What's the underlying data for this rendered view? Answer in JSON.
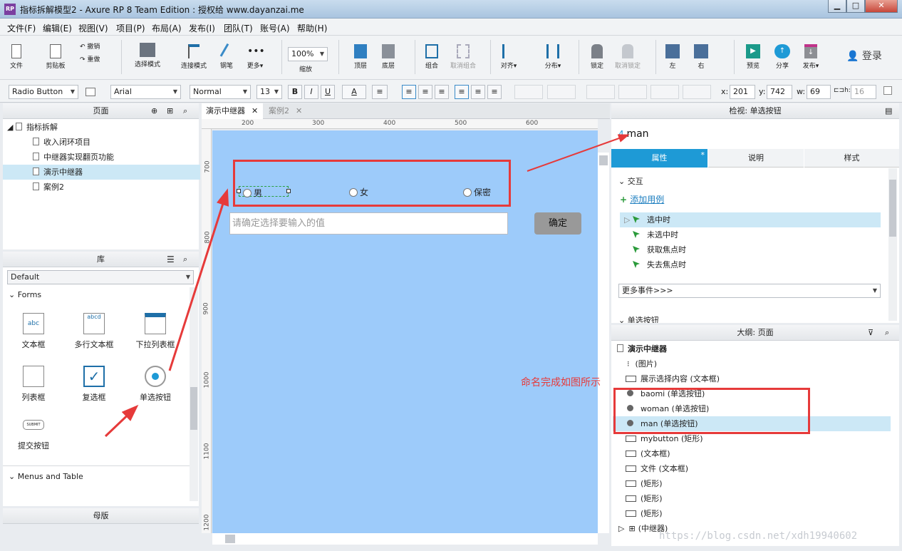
{
  "window": {
    "title": "指标拆解模型2 - Axure RP 8 Team Edition : 授权给 www.dayanzai.me",
    "app_icon": "RP",
    "min": "▁",
    "max": "□",
    "close": "✕"
  },
  "menu": [
    "文件(F)",
    "编辑(E)",
    "视图(V)",
    "项目(P)",
    "布局(A)",
    "发布(I)",
    "团队(T)",
    "账号(A)",
    "帮助(H)"
  ],
  "toolbar": {
    "file": "文件",
    "clipboard": "剪贴板",
    "undo": "撤销",
    "redo": "重做",
    "select_mode": "选择模式",
    "connect_mode": "连接模式",
    "pen": "钢笔",
    "more": "更多▾",
    "zoom_value": "100%",
    "zoom": "缩放",
    "top": "顶层",
    "bottom": "底层",
    "group": "组合",
    "ungroup": "取消组合",
    "align": "对齐▾",
    "distribute": "分布▾",
    "lock": "锁定",
    "unlock": "取消锁定",
    "left": "左",
    "right": "右",
    "preview": "预览",
    "share": "分享",
    "publish": "发布▾",
    "login": "登录"
  },
  "format": {
    "widget_type": "Radio Button",
    "font": "Arial",
    "style": "Normal",
    "size": "13",
    "bold": "B",
    "italic": "I",
    "underline": "U",
    "font_color": "A",
    "x_label": "x:",
    "x": "201",
    "y_label": "y:",
    "y": "742",
    "w_label": "w:",
    "w": "69",
    "h": "16"
  },
  "pages": {
    "title": "页面",
    "root": "指标拆解",
    "items": [
      "收入闭环项目",
      "中继器实现翻页功能",
      "演示中继器",
      "案例2"
    ],
    "selected": 2
  },
  "library": {
    "title": "库",
    "selected": "Default",
    "section": "Forms",
    "items": [
      "文本框",
      "多行文本框",
      "下拉列表框",
      "列表框",
      "复选框",
      "单选按钮",
      "提交按钮"
    ],
    "section2": "Menus and Table",
    "masters": "母版"
  },
  "tabs": [
    {
      "label": "演示中继器",
      "close": "✕"
    },
    {
      "label": "案例2",
      "close": "✕"
    }
  ],
  "ruler": {
    "h": [
      "200",
      "300",
      "400",
      "500",
      "600",
      "700"
    ],
    "v": [
      "700",
      "800",
      "900",
      "1000",
      "1100",
      "1200"
    ]
  },
  "canvas": {
    "radio_male": "男",
    "radio_female": "女",
    "radio_secret": "保密",
    "input_placeholder": "请确定选择要输入的值",
    "confirm": "确定"
  },
  "inspector": {
    "title": "检视: 单选按钮",
    "name": "man",
    "tabs": [
      "属性",
      "说明",
      "样式"
    ],
    "active_mark": "*",
    "interaction": "交互",
    "add_case": "添加用例",
    "events": [
      "选中时",
      "未选中时",
      "获取焦点时",
      "失去焦点时"
    ],
    "more_events": "更多事件>>>",
    "next_section": "单选按钮"
  },
  "outline": {
    "title": "大纲: 页面",
    "page": "演示中继器",
    "items": [
      "(图片)",
      "展示选择内容 (文本框)",
      "baomi (单选按钮)",
      "woman (单选按钮)",
      "man (单选按钮)",
      "mybutton (矩形)",
      "(文本框)",
      "文件 (文本框)",
      "(矩形)",
      "(矩形)",
      "(矩形)",
      "(中继器)"
    ]
  },
  "annotation": "命名完成如图所示",
  "watermark": "https://blog.csdn.net/xdh19940602",
  "colors": {
    "accent": "#1e9ad6",
    "canvas": "#9dcbfa",
    "annotation": "#e63a3a"
  }
}
